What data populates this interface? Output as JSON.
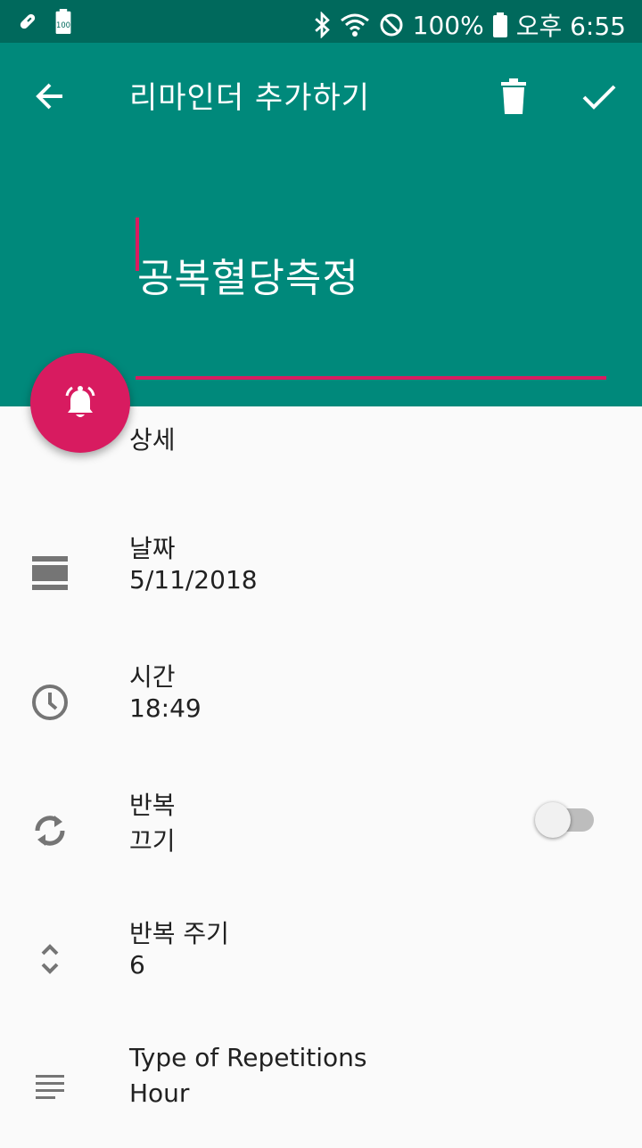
{
  "status_bar": {
    "battery_percent": "100%",
    "time": "오후 6:55",
    "left_icons": [
      "pill-icon",
      "battery-saver-icon"
    ],
    "right_icons": [
      "bluetooth-icon",
      "wifi-icon",
      "do-not-disturb-icon",
      "battery-icon"
    ]
  },
  "toolbar": {
    "title": "리마인더 추가하기",
    "back_icon": "arrow-back-icon",
    "delete_icon": "trash-icon",
    "done_icon": "check-icon"
  },
  "reminder": {
    "title_value": "공복혈당측정",
    "title_placeholder": ""
  },
  "fab": {
    "icon": "bell-ringing-icon"
  },
  "details_heading": "상세",
  "settings": {
    "date": {
      "label": "날짜",
      "value": "5/11/2018",
      "icon": "calendar-icon"
    },
    "time": {
      "label": "시간",
      "value": "18:49",
      "icon": "clock-icon"
    },
    "repeat": {
      "label": "반복",
      "value": "끄기",
      "icon": "repeat-icon",
      "enabled": false
    },
    "repeat_interval": {
      "label": "반복 주기",
      "value": "6",
      "icon": "unfold-icon"
    },
    "repeat_type": {
      "label": "Type of Repetitions",
      "value": "Hour",
      "icon": "list-icon"
    }
  },
  "colors": {
    "primary": "#00897b",
    "primary_dark": "#00695c",
    "accent": "#d81b60",
    "background": "#fafafa",
    "icon_gray": "#757575"
  }
}
